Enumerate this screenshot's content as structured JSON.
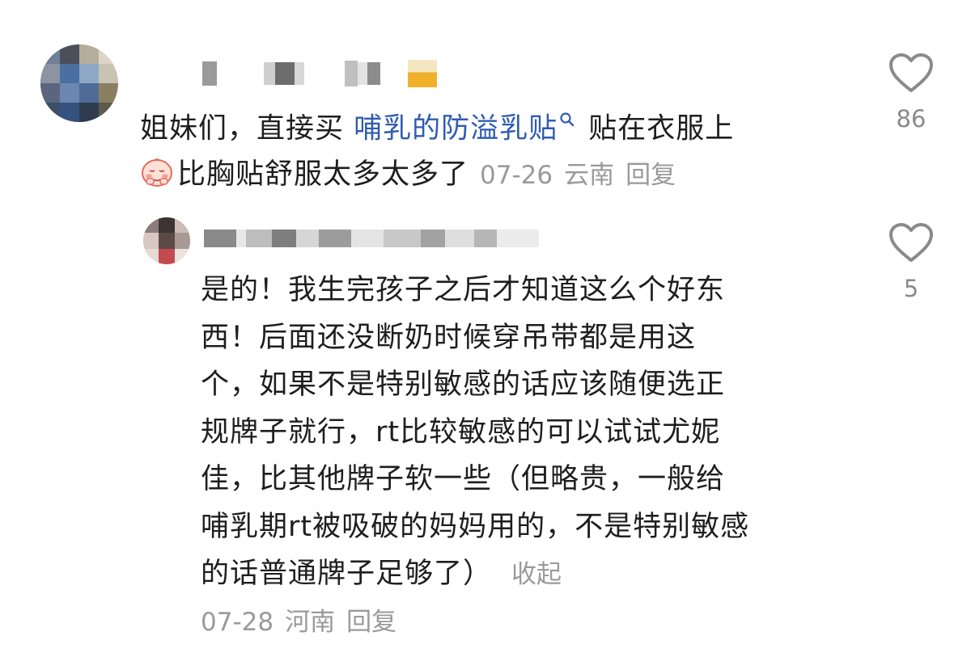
{
  "comment": {
    "text_prefix": "姐妹们，直接买 ",
    "link_text": "哺乳的防溢乳贴",
    "text_after_link": " 贴在衣服上",
    "line2_text": "比胸贴舒服太多太多了",
    "date": "07-26",
    "location": "云南",
    "reply_label": "回复",
    "like_count": "86"
  },
  "reply": {
    "lines": [
      "是的！我生完孩子之后才知道这么个好东",
      "西！后面还没断奶时候穿吊带都是用这",
      "个，如果不是特别敏感的话应该随便选正",
      "规牌子就行，rt比较敏感的可以试试尤妮",
      "佳，比其他牌子软一些（但略贵，一般给",
      "哺乳期rt被吸破的妈妈用的，不是特别敏感",
      "的话普通牌子足够了）"
    ],
    "collapse_label": "收起",
    "date": "07-28",
    "location": "河南",
    "reply_label": "回复",
    "like_count": "5"
  },
  "icons": {
    "like": "heart-outline-icon",
    "search": "search-icon",
    "emoji": "shy-face-emoji-icon"
  },
  "colors": {
    "link": "#2f5cb0",
    "meta": "#9a9a9a",
    "text": "#1e1e1e"
  }
}
